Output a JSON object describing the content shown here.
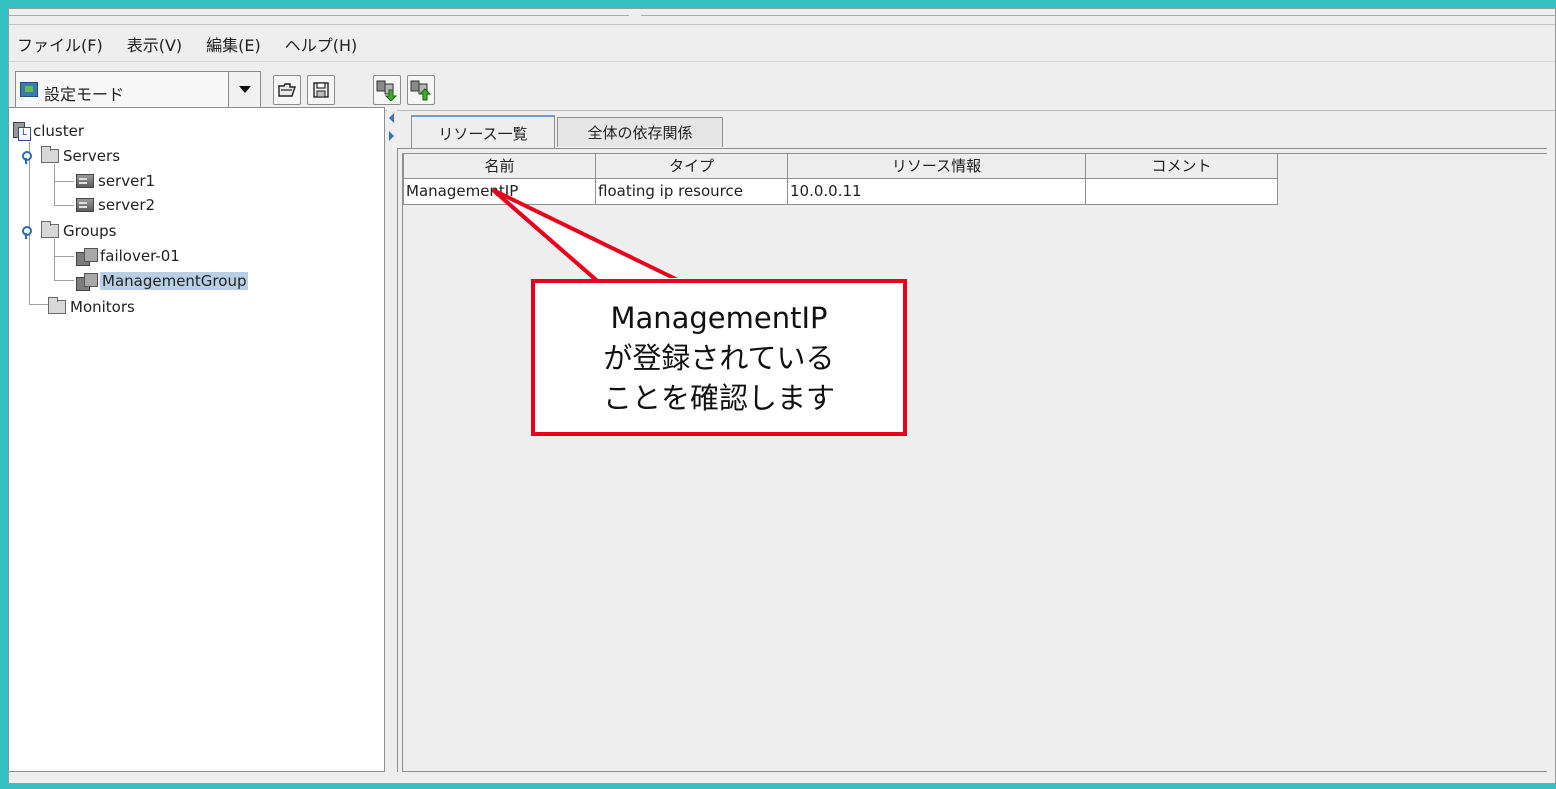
{
  "menu": {
    "items": [
      "ファイル(F)",
      "表示(V)",
      "編集(E)",
      "ヘルプ(H)"
    ]
  },
  "toolbar": {
    "mode_label": "設定モード",
    "buttons": [
      "open-icon",
      "save-icon",
      "download-icon",
      "upload-icon"
    ]
  },
  "tree": {
    "root": "cluster",
    "servers": {
      "label": "Servers",
      "items": [
        "server1",
        "server2"
      ]
    },
    "groups": {
      "label": "Groups",
      "items": [
        "failover-01",
        "ManagementGroup"
      ],
      "selected": "ManagementGroup"
    },
    "monitors": {
      "label": "Monitors"
    }
  },
  "tabs": [
    {
      "label": "リソース一覧",
      "active": true
    },
    {
      "label": "全体の依存関係",
      "active": false
    }
  ],
  "resource_table": {
    "headers": [
      "名前",
      "タイプ",
      "リソース情報",
      "コメント"
    ],
    "rows": [
      [
        "ManagementIP",
        "floating ip resource",
        "10.0.0.11",
        ""
      ]
    ]
  },
  "callout": {
    "lines": [
      "ManagementIP",
      "が登録されている",
      "ことを確認します"
    ],
    "border_color": "#e8001c"
  },
  "colors": {
    "frame": "#35c0c3",
    "selection": "#b8cfe5",
    "tab_accent": "#6e9ecf"
  }
}
